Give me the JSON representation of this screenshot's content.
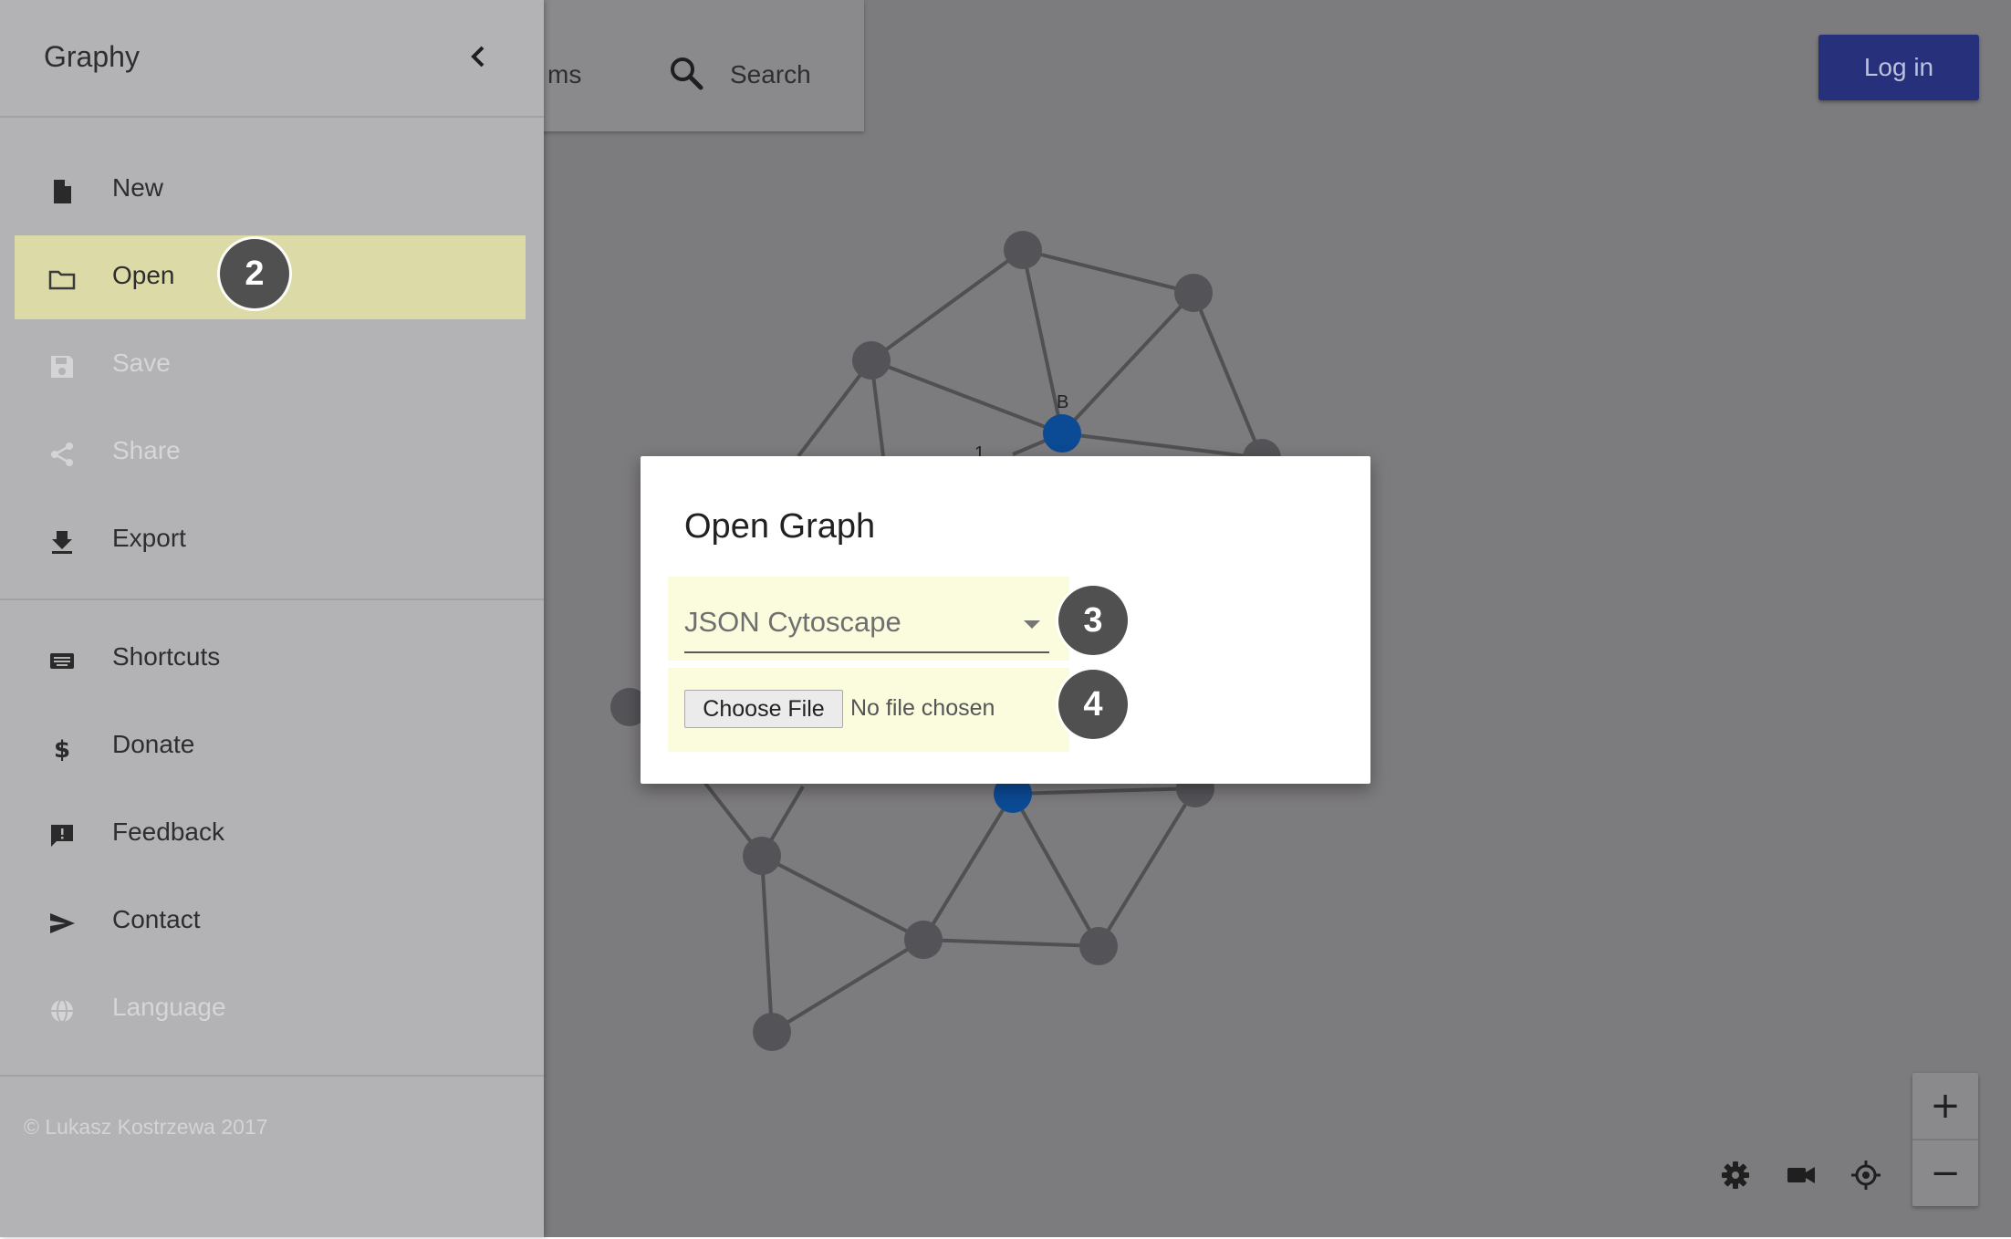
{
  "toolbar": {
    "items_label": "ms",
    "search_label": "Search",
    "login_label": "Log in"
  },
  "drawer": {
    "title": "Graphy",
    "menu": [
      {
        "label": "New",
        "icon": "file-icon",
        "disabled": false
      },
      {
        "label": "Open",
        "icon": "folder-icon",
        "disabled": false,
        "highlighted": true
      },
      {
        "label": "Save",
        "icon": "save-icon",
        "disabled": true
      },
      {
        "label": "Share",
        "icon": "share-icon",
        "disabled": true
      },
      {
        "label": "Export",
        "icon": "download-icon",
        "disabled": false
      }
    ],
    "menu2": [
      {
        "label": "Shortcuts",
        "icon": "keyboard-icon",
        "disabled": false
      },
      {
        "label": "Donate",
        "icon": "dollar-icon",
        "disabled": false
      },
      {
        "label": "Feedback",
        "icon": "feedback-icon",
        "disabled": false
      },
      {
        "label": "Contact",
        "icon": "send-icon",
        "disabled": false
      },
      {
        "label": "Language",
        "icon": "globe-icon",
        "disabled": true
      }
    ],
    "copyright": "© Lukasz Kostrzewa 2017"
  },
  "dialog": {
    "title": "Open Graph",
    "format_value": "JSON Cytoscape",
    "choose_file_label": "Choose File",
    "file_status": "No file chosen"
  },
  "badges": {
    "step2": "2",
    "step3": "3",
    "step4": "4"
  },
  "graph": {
    "node_label_b": "B",
    "edge_label_1": "1"
  },
  "controls": {
    "zoom_in": "+",
    "zoom_out": "−"
  },
  "colors": {
    "backdrop": "#7c7b7e",
    "drawer": "#b3b2b5",
    "highlight": "#dcdba7",
    "dialog_highlight": "#fbfbde",
    "login_button": "#27307a",
    "node_gray": "#545357",
    "node_blue": "#0b4a94",
    "badge": "#505050"
  }
}
